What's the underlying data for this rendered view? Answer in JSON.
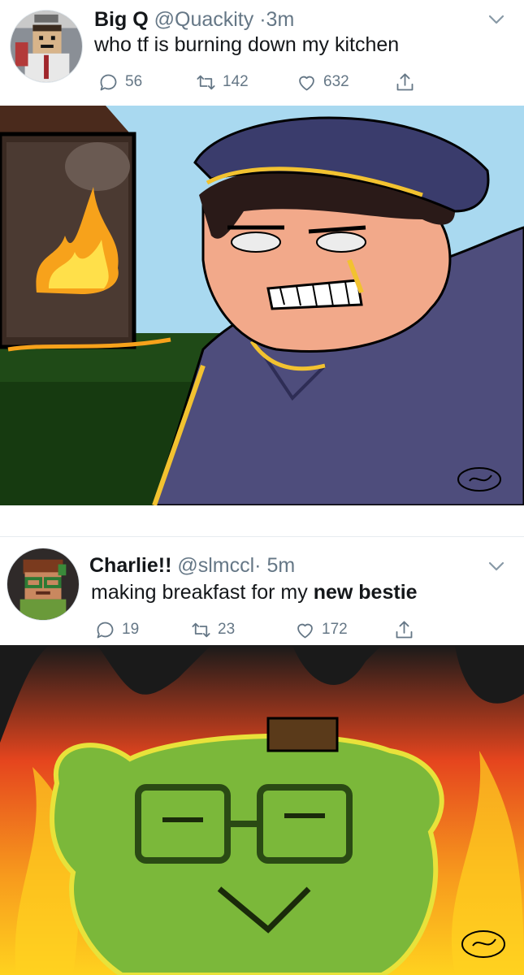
{
  "tweets": [
    {
      "display_name": "Big Q",
      "handle": "@Quackity",
      "separator": "·",
      "time": "3m",
      "text": "who tf is burning down my kitchen",
      "reply_count": "56",
      "retweet_count": "142",
      "like_count": "632",
      "avatar_icon": "pixel-avatar-quackity",
      "media_description_icon": "drawing-burning-kitchen"
    },
    {
      "display_name": "Charlie!!",
      "handle": "@slmccl",
      "separator": "·",
      "time": "5m",
      "text_plain": "making breakfast for my ",
      "text_bold": "new bestie",
      "reply_count": "19",
      "retweet_count": "23",
      "like_count": "172",
      "avatar_icon": "pixel-avatar-charlie",
      "media_description_icon": "drawing-green-face-fire"
    }
  ],
  "colors": {
    "text": "#14171a",
    "secondary": "#657786",
    "divider": "#e6ecf0",
    "sky": "#a9d9f0",
    "fire": "#f7a21b",
    "jacket": "#4e4d7c",
    "grass": "#1f4a17"
  },
  "icons": [
    "reply-icon",
    "retweet-icon",
    "like-icon",
    "share-icon",
    "chevron-down-icon"
  ]
}
